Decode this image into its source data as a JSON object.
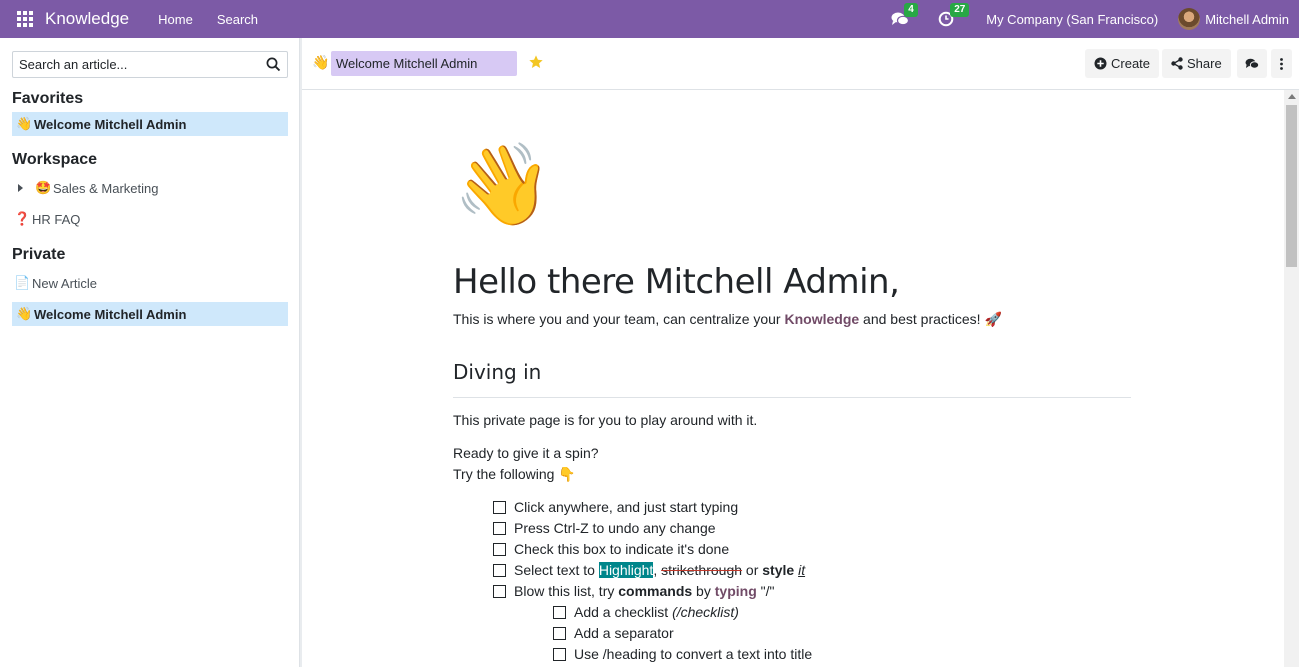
{
  "topbar": {
    "app_title": "Knowledge",
    "nav": [
      "Home",
      "Search"
    ],
    "messages_count": "4",
    "activities_count": "27",
    "company": "My Company (San Francisco)",
    "user": "Mitchell Admin"
  },
  "sidebar": {
    "search_placeholder": "Search an article...",
    "favorites_title": "Favorites",
    "favorites": [
      {
        "emoji": "👋",
        "label": "Welcome Mitchell Admin"
      }
    ],
    "workspace_title": "Workspace",
    "workspace": [
      {
        "emoji": "🤩",
        "label": "Sales & Marketing"
      },
      {
        "emoji": "❓",
        "label": "HR FAQ"
      }
    ],
    "private_title": "Private",
    "private": [
      {
        "emoji": "📄",
        "label": "New Article"
      },
      {
        "emoji": "👋",
        "label": "Welcome Mitchell Admin"
      }
    ]
  },
  "header": {
    "emoji": "👋",
    "title": "Welcome Mitchell Admin",
    "create_label": "Create",
    "share_label": "Share"
  },
  "article": {
    "icon": "👋",
    "heading": "Hello there Mitchell Admin,",
    "intro_before": "This is where you and your team, can centralize your ",
    "intro_keyword": "Knowledge",
    "intro_after": " and best practices! 🚀",
    "section_title": "Diving in",
    "para1": "This private page is for you to play around with it.",
    "para2_line1": "Ready to give it a spin?",
    "para2_line2": "Try the following 👇",
    "checklist": [
      "Click anywhere, and just start typing",
      "Press Ctrl-Z to undo any change",
      "Check this box to indicate it's done"
    ],
    "select_text": {
      "before": "Select text to ",
      "highlight": "Highlight",
      "comma": ", ",
      "strike": "strikethrough",
      "or": " or ",
      "style": "style",
      "space": " ",
      "it": "it"
    },
    "commands_line": {
      "before": "Blow this list, try ",
      "commands": "commands",
      "by": " by ",
      "typing": "typing",
      "after": " \"/\""
    },
    "sub_checklist": {
      "item1_text": "Add a checklist ",
      "item1_italic": "(/checklist)",
      "item2": "Add a separator",
      "item3": "Use /heading to convert a text into title"
    }
  },
  "colors": {
    "topbar": "#7c5aa6",
    "active_item": "#cfe8fb",
    "title_field": "#d7c9f4",
    "highlight": "#00868b",
    "badge": "#28a745",
    "keyword": "#714b67"
  }
}
